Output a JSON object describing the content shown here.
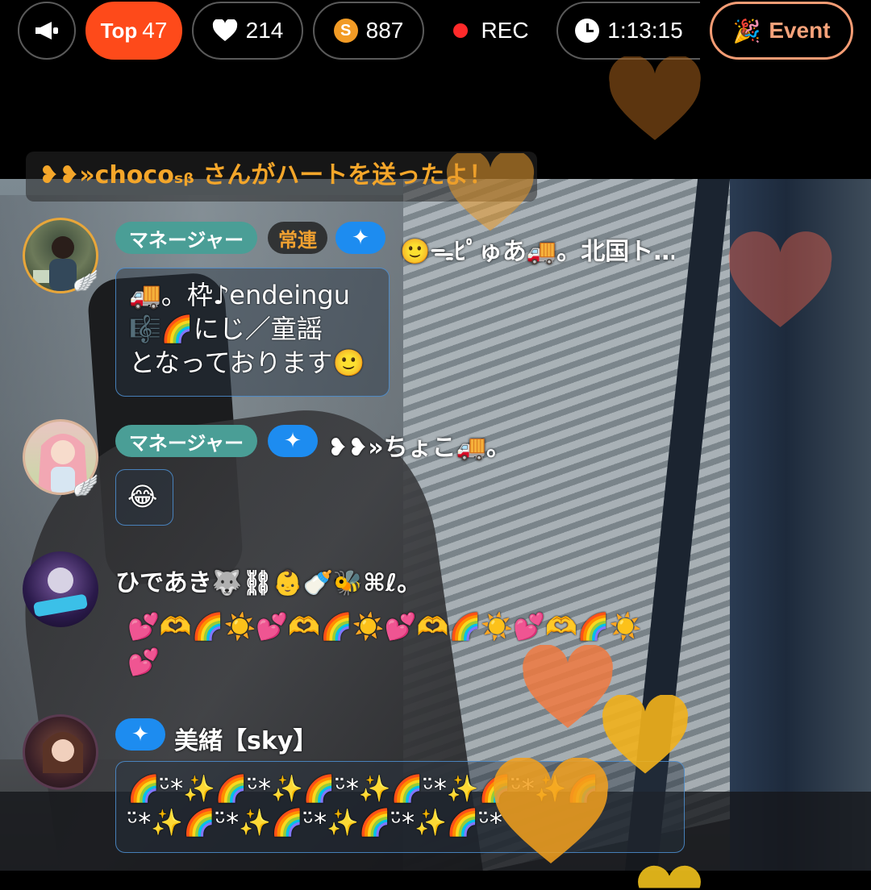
{
  "topbar": {
    "megaphone_icon": "megaphone-icon",
    "rank_prefix": "Top",
    "rank_value": "47",
    "hearts": "214",
    "coins": "887",
    "coin_symbol": "S",
    "rec_label": "REC",
    "timer": "1:13:15",
    "event_label": "Event"
  },
  "banner": {
    "text": "❥❥»chocoₛᵦ さんがハートを送ったよ！"
  },
  "messages": [
    {
      "badges": [
        "マネージャー",
        "常連",
        "✦"
      ],
      "username": "🙂ᯓﾋﾟゅあ🚚。北国ト…",
      "text_lines": [
        "🚚。枠♪endeingu",
        "🎼🌈にじ／童謡",
        "となっております🙂"
      ]
    },
    {
      "badges": [
        "マネージャー",
        "✦"
      ],
      "username": "❥❥»ちょこ🚚。",
      "text_lines": [
        "😂"
      ]
    },
    {
      "badges": [],
      "username": "ひであき🐺⛓👶🍼🐝⌘ℓ。",
      "text_lines": [
        "💕🫶🌈☀️💕🫶🌈☀️💕🫶🌈☀️💕🫶🌈☀️",
        "💕"
      ]
    },
    {
      "badges": [
        "✦"
      ],
      "username": "美緒【sky】",
      "text_lines": [
        "🌈ᵕ̈*✨🌈ᵕ̈*✨🌈ᵕ̈*✨🌈ᵕ̈*✨🌈ᵕ̈*✨🌈",
        "ᵕ̈*✨🌈ᵕ̈*✨🌈ᵕ̈*✨🌈ᵕ̈*✨🌈ᵕ̈*"
      ]
    }
  ],
  "colors": {
    "rank_pill": "#fe4a1a",
    "event_border": "#f59c74",
    "event_text": "#f7a27a",
    "banner_text": "#f4a62a",
    "manager_tag": "#4a9e96",
    "plus_tag": "#1d8cf0"
  }
}
